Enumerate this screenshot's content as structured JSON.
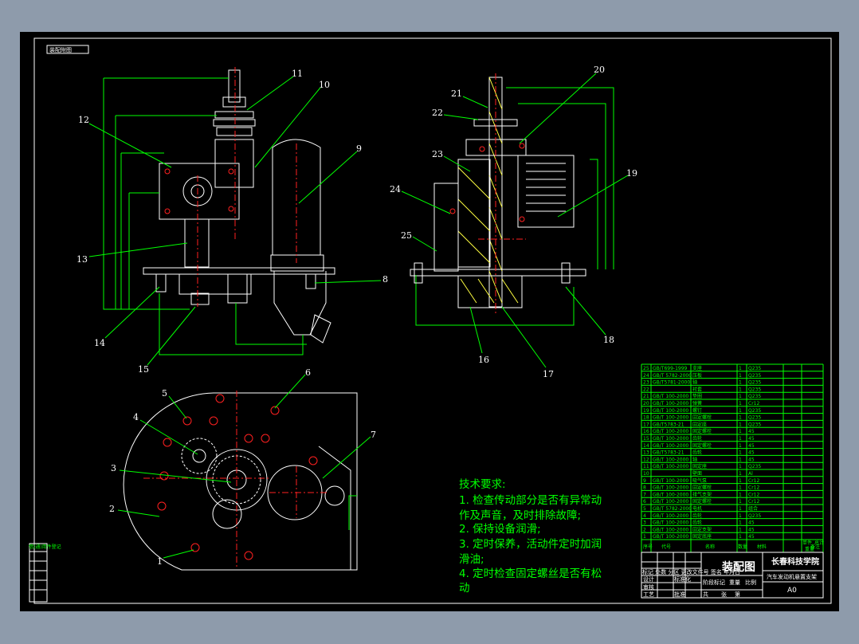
{
  "colors": {
    "background": "#8e9bab",
    "canvas": "#000000",
    "border": "#ffffff",
    "dimension": "#00ff00",
    "centerline": "#ff2020",
    "hatch": "#ffff40"
  },
  "sheet_tag": "装配附图",
  "balloons": [
    {
      "id": "1",
      "text": "1"
    },
    {
      "id": "2",
      "text": "2"
    },
    {
      "id": "3",
      "text": "3"
    },
    {
      "id": "4",
      "text": "4"
    },
    {
      "id": "5",
      "text": "5"
    },
    {
      "id": "6",
      "text": "6"
    },
    {
      "id": "7",
      "text": "7"
    },
    {
      "id": "8",
      "text": "8"
    },
    {
      "id": "9",
      "text": "9"
    },
    {
      "id": "10",
      "text": "10"
    },
    {
      "id": "11",
      "text": "11"
    },
    {
      "id": "12",
      "text": "12"
    },
    {
      "id": "13",
      "text": "13"
    },
    {
      "id": "14",
      "text": "14"
    },
    {
      "id": "15",
      "text": "15"
    },
    {
      "id": "16",
      "text": "16"
    },
    {
      "id": "17",
      "text": "17"
    },
    {
      "id": "18",
      "text": "18"
    },
    {
      "id": "19",
      "text": "19"
    },
    {
      "id": "20",
      "text": "20"
    },
    {
      "id": "21",
      "text": "21"
    },
    {
      "id": "22",
      "text": "22"
    },
    {
      "id": "23",
      "text": "23"
    },
    {
      "id": "24",
      "text": "24"
    },
    {
      "id": "25",
      "text": "25"
    }
  ],
  "tech_requirements": {
    "title": "技术要求:",
    "lines": [
      "1. 检查传动部分是否有异常动",
      "作及声音，及时排除故障;",
      "2. 保持设备润滑;",
      "3. 定时保养，活动件定时加润",
      "滑油;",
      "4. 定时检查固定螺丝是否有松",
      "动"
    ]
  },
  "parts_list": {
    "header": {
      "no": "序号",
      "code": "代号",
      "name": "名称",
      "qty": "数量",
      "material": "材料",
      "weight_single": "单件",
      "weight_total": "总计",
      "weight": "重量",
      "remark": "备注"
    },
    "rows": [
      {
        "no": "25",
        "code": "GB/T699-1999",
        "name": "支座",
        "qty": "1",
        "material": "Q235"
      },
      {
        "no": "24",
        "code": "GB/T 5782-2000",
        "name": "压板",
        "qty": "1",
        "material": "Q235"
      },
      {
        "no": "23",
        "code": "GB/T5781-2000",
        "name": "轴",
        "qty": "1",
        "material": "Q235"
      },
      {
        "no": "22",
        "code": "",
        "name": "衬套",
        "qty": "1",
        "material": "Q235"
      },
      {
        "no": "21",
        "code": "GB/T 100-2000",
        "name": "垫圈",
        "qty": "1",
        "material": "Q235"
      },
      {
        "no": "20",
        "code": "GB/T 100-2000",
        "name": "弹簧",
        "qty": "1",
        "material": "Cr12"
      },
      {
        "no": "19",
        "code": "GB/T 100-2000",
        "name": "螺钉",
        "qty": "1",
        "material": "Q235"
      },
      {
        "no": "18",
        "code": "GB/T 100-2000",
        "name": "固定螺栓",
        "qty": "1",
        "material": "Q235"
      },
      {
        "no": "17",
        "code": "GB/T5783-21",
        "name": "固定座",
        "qty": "1",
        "material": "Q235"
      },
      {
        "no": "16",
        "code": "GB/T 100-2000",
        "name": "固定螺栓",
        "qty": "1",
        "material": "45"
      },
      {
        "no": "15",
        "code": "GB/T 100-2000",
        "name": "齿轮",
        "qty": "1",
        "material": "45"
      },
      {
        "no": "14",
        "code": "GB/T 100-2000",
        "name": "固定螺栓",
        "qty": "1",
        "material": "45"
      },
      {
        "no": "13",
        "code": "GB/T5783-21",
        "name": "齿轮",
        "qty": "1",
        "material": "45"
      },
      {
        "no": "12",
        "code": "GB/T 100-2000",
        "name": "轴",
        "qty": "1",
        "material": "45"
      },
      {
        "no": "11",
        "code": "GB/T 100-2000",
        "name": "固定座",
        "qty": "1",
        "material": "Q235"
      },
      {
        "no": "10",
        "code": "",
        "name": "壁面",
        "qty": "1",
        "material": "Al"
      },
      {
        "no": "9",
        "code": "GB/T 100-2000",
        "name": "吸气泵",
        "qty": "1",
        "material": "Cr12"
      },
      {
        "no": "8",
        "code": "GB/T 100-2000",
        "name": "固定螺栓",
        "qty": "1",
        "material": "Cr12"
      },
      {
        "no": "7",
        "code": "GB/T 100-2000",
        "name": "排气支架",
        "qty": "1",
        "material": "Cr12"
      },
      {
        "no": "6",
        "code": "GB/T 100-2000",
        "name": "固定螺栓",
        "qty": "1",
        "material": "Cr12"
      },
      {
        "no": "5",
        "code": "GB/T 5782-2000",
        "name": "电机",
        "qty": "1",
        "material": "组合"
      },
      {
        "no": "4",
        "code": "GB/T 100-2000",
        "name": "齿轮",
        "qty": "1",
        "material": "Q235"
      },
      {
        "no": "3",
        "code": "GB/T 100-2000",
        "name": "齿轮",
        "qty": "1",
        "material": "45"
      },
      {
        "no": "2",
        "code": "GB/T 100-2000",
        "name": "固定支架",
        "qty": "1",
        "material": "45"
      },
      {
        "no": "1",
        "code": "GB/T 100-2000",
        "name": "固定底座",
        "qty": "1",
        "material": "45"
      }
    ]
  },
  "title_block": {
    "drawing_type": "装配图",
    "school": "长春科技学院",
    "drawing_name": "汽车发动机悬置支架",
    "size": "A0",
    "revision_row": "标记 处数 分区 更改文件号 签名 年月日",
    "design": "设计",
    "standardize": "标准化",
    "review": "审核",
    "process": "工艺",
    "approve": "批准",
    "stage_label": "阶段标记",
    "weight_label": "重量",
    "scale_label": "比例",
    "sheets_total": "共",
    "sheets_unit": "张",
    "sheet_no": "第"
  },
  "side_strip": {
    "label": "借(通)用件登记"
  }
}
